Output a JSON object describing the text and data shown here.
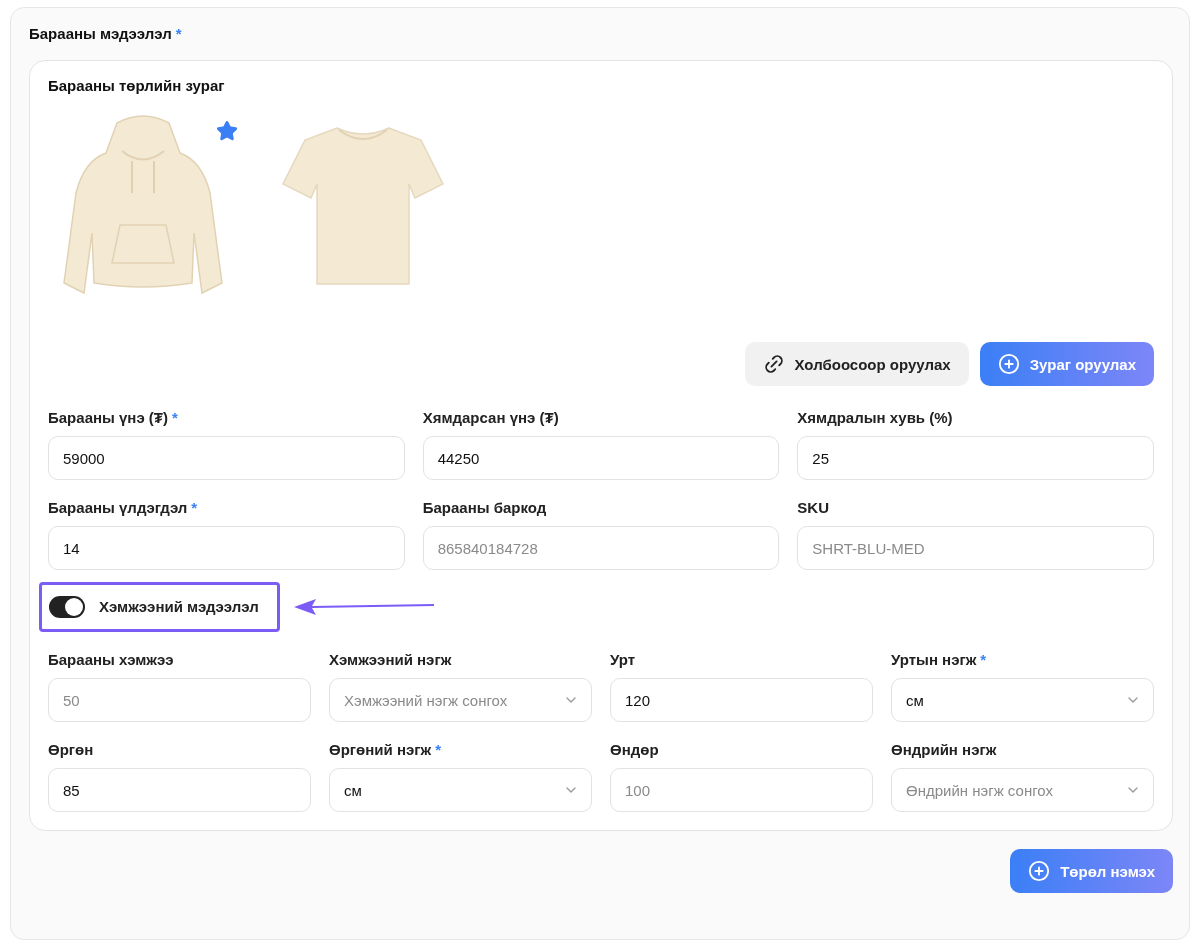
{
  "section": {
    "title": "Барааны мэдээлэл",
    "mark": "*"
  },
  "images": {
    "title": "Барааны төрлийн зураг",
    "items": [
      {
        "kind": "hoodie",
        "selected": true
      },
      {
        "kind": "tshirt",
        "selected": false
      }
    ]
  },
  "image_buttons": [
    {
      "kind": "link",
      "label": "Холбоосоор оруулах"
    },
    {
      "kind": "upload",
      "label": "Зураг оруулах"
    }
  ],
  "product_fields": [
    {
      "kind": "input",
      "label": "Барааны үнэ (₮)",
      "mark": "*",
      "value": "59000"
    },
    {
      "kind": "input",
      "label": "Хямдарсан үнэ (₮)",
      "value": "44250"
    },
    {
      "kind": "input",
      "label": "Хямдралын хувь (%)",
      "value": "25"
    },
    {
      "kind": "input",
      "label": "Барааны үлдэгдэл",
      "mark": "*",
      "value": "14"
    },
    {
      "kind": "input",
      "label": "Барааны баркод",
      "placeholder": "865840184728"
    },
    {
      "kind": "input",
      "label": "SKU",
      "placeholder": "SHRT-BLU-MED"
    }
  ],
  "size_info": {
    "toggle": {
      "label": "Хэмжээний мэдээлэл",
      "on": true,
      "highlighted": true
    },
    "fields": [
      {
        "kind": "input",
        "label": "Барааны хэмжээ",
        "placeholder": "50"
      },
      {
        "kind": "select",
        "label": "Хэмжээний нэгж",
        "placeholder": "Хэмжээний нэгж сонгох"
      },
      {
        "kind": "input",
        "label": "Урт",
        "value": "120"
      },
      {
        "kind": "select",
        "label": "Уртын нэгж",
        "mark": "*",
        "value": "см"
      },
      {
        "kind": "input",
        "label": "Өргөн",
        "value": "85"
      },
      {
        "kind": "select",
        "label": "Өргөний нэгж",
        "mark": "*",
        "value": "см"
      },
      {
        "kind": "input",
        "label": "Өндөр",
        "placeholder": "100"
      },
      {
        "kind": "select",
        "label": "Өндрийн нэгж",
        "placeholder": "Өндрийн нэгж сонгох"
      }
    ]
  },
  "add_button": {
    "label": "Төрөл нэмэх"
  }
}
